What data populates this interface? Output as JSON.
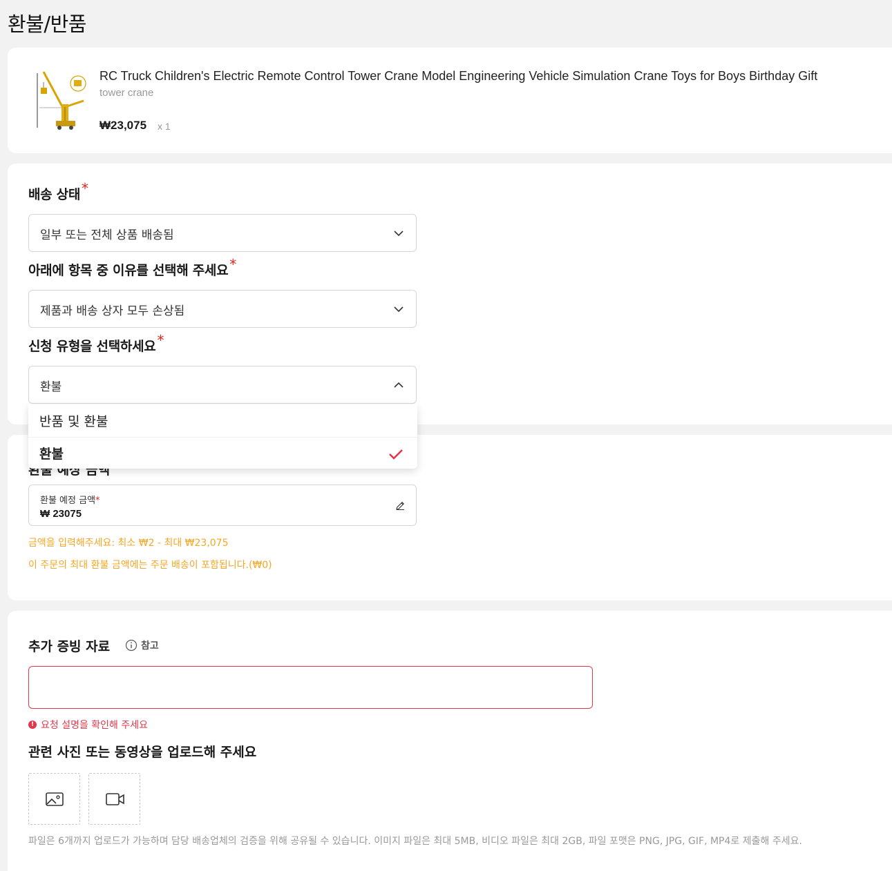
{
  "page": {
    "title": "환불/반품"
  },
  "product": {
    "title": "RC Truck Children's Electric Remote Control Tower Crane Model Engineering Vehicle Simulation Crane Toys for Boys Birthday Gift",
    "sku": "tower crane",
    "price": "₩23,075",
    "quantity": "x 1"
  },
  "form": {
    "shipping_status": {
      "label": "배송 상태",
      "required": "*",
      "value": "일부 또는 전체 상품 배송됨"
    },
    "reason": {
      "label": "아래에 항목 중 이유를 선택해 주세요",
      "required": "*",
      "value": "제품과 배송 상자 모두 손상됨"
    },
    "request_type": {
      "label": "신청 유형을 선택하세요",
      "required": "*",
      "value": "환불",
      "options": [
        "반품 및 환불",
        "환불"
      ],
      "selected_option": "환불"
    }
  },
  "amount": {
    "section_label": "환불 예상 금액",
    "field_caption": "환불 예정 금액",
    "required": "*",
    "value": "₩ 23075",
    "hint_range": "금액을 입력해주세요: 최소 ₩2 - 최대 ₩23,075",
    "hint_shipping": "이 주문의 최대 환불 금액에는 주문 배송이 포함됩니다.(₩0)"
  },
  "evidence": {
    "title": "추가 증빙 자료",
    "reference": "참고",
    "error": "요청 설명을 확인해 주세요",
    "upload_title": "관련 사진 또는 동영상을 업로드해 주세요",
    "upload_note": "파일은 6개까지 업로드가 가능하며 담당 배송업체의 검증을 위해 공유될 수 있습니다. 이미지 파일은 최대 5MB, 비디오 파일은 최대 2GB, 파일 포맷은 PNG, JPG, GIF, MP4로 제출해 주세요."
  },
  "colors": {
    "required": "#e1251b",
    "error": "#e1394b",
    "hint": "#f5a623",
    "check": "#e1394b"
  }
}
